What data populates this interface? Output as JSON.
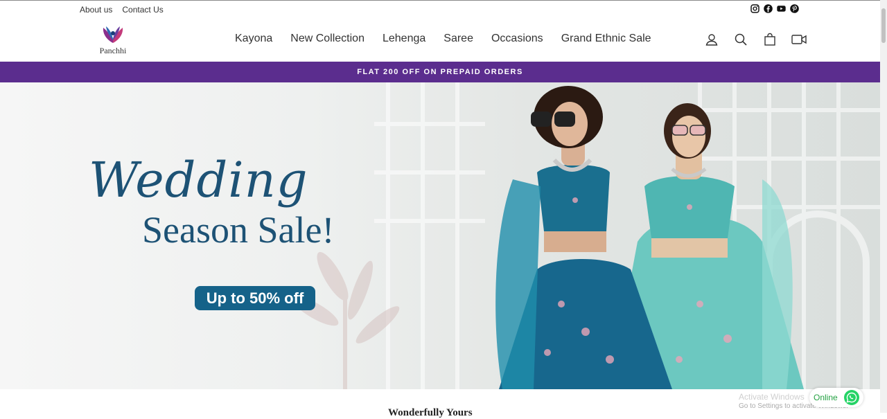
{
  "topbar": {
    "links": [
      "About us",
      "Contact Us"
    ]
  },
  "brand": {
    "name": "Panchhi"
  },
  "nav": {
    "items": [
      "Kayona",
      "New Collection",
      "Lehenga",
      "Saree",
      "Occasions",
      "Grand Ethnic Sale"
    ]
  },
  "promo": {
    "text": "FLAT 200 OFF ON PREPAID ORDERS"
  },
  "hero": {
    "title_script": "Wedding",
    "title_main": "Season Sale!",
    "offer": "Up to 50% off"
  },
  "section": {
    "title": "Wonderfully Yours"
  },
  "watermark": {
    "line1": "Activate Windows",
    "line2": "Go to Settings to activate Windows."
  },
  "chat": {
    "status": "Online"
  },
  "colors": {
    "promo_bg": "#5b2d8e",
    "hero_text": "#1d5275",
    "offer_bg": "#156289",
    "whatsapp": "#25d366"
  }
}
